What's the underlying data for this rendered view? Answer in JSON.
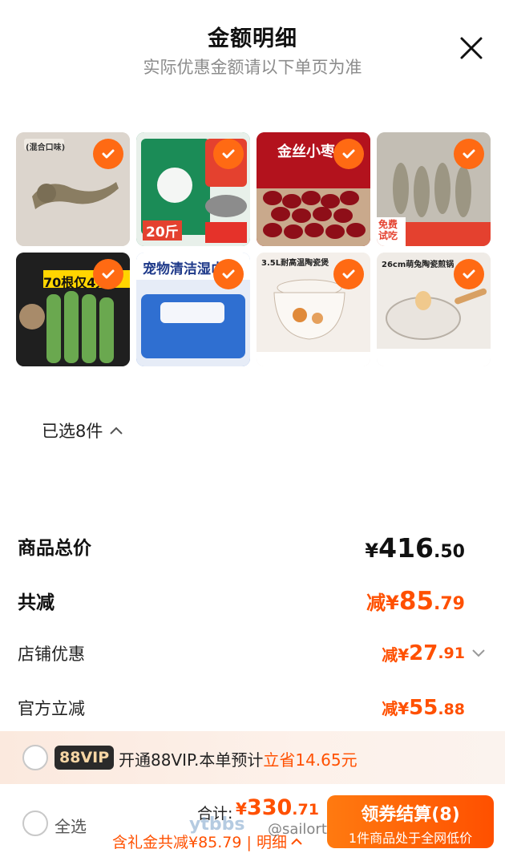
{
  "header": {
    "title": "金额明细",
    "subtitle": "实际优惠金额请以下单页为准"
  },
  "products": [
    {
      "name": "cat-toy",
      "tag": "(混合口味)",
      "bg": "#d7d0c8"
    },
    {
      "name": "cat-litter",
      "tag": "20斤",
      "bg": "#1d8a5a"
    },
    {
      "name": "red-dates",
      "tag": "金丝小枣",
      "bg": "#a5121c"
    },
    {
      "name": "dried-fish",
      "tag": "免费试吃",
      "bg": "#c7c2b8"
    },
    {
      "name": "cat-grass-sticks",
      "tag": "70根仅4元",
      "bg": "#2c2c2c"
    },
    {
      "name": "pet-wipes",
      "tag": "宠物清洁湿巾",
      "bg": "#2f6fd1"
    },
    {
      "name": "ceramic-pot",
      "tag": "3.5L耐高温陶瓷煲",
      "bg": "#f2ece6"
    },
    {
      "name": "ceramic-pan",
      "tag": "26cm萌兔陶瓷煎锅",
      "bg": "#ede9e4"
    }
  ],
  "selected_count_label": "已选8件",
  "summary": {
    "total_label": "商品总价",
    "total_yen": "¥",
    "total_int": "416",
    "total_dec": ".50",
    "discount_label": "共减",
    "discount_prefix": "减¥",
    "discount_int": "85",
    "discount_dec": ".79",
    "shop_label": "店铺优惠",
    "shop_prefix": "减¥",
    "shop_int": "27",
    "shop_dec": ".91",
    "official_label": "官方立减",
    "official_prefix": "减¥",
    "official_int": "55",
    "official_dec": ".88"
  },
  "vip": {
    "badge": "88VIP",
    "text": "开通88VIP.本单预计",
    "highlight": "立省14.65元"
  },
  "bottom": {
    "select_all": "全选",
    "total_label": "合计:",
    "total_yen": "¥",
    "total_int": "330",
    "total_dec": ".71",
    "gift_text": "含礼金共减¥85.79 | 明细",
    "checkout_label": "领券结算(8)",
    "checkout_sub": "1件商品处于全网低价",
    "watermark": "ytbbs",
    "watermark_user": "@sailortu"
  },
  "colors": {
    "accent": "#ff5000",
    "check": "#ff6a13"
  }
}
